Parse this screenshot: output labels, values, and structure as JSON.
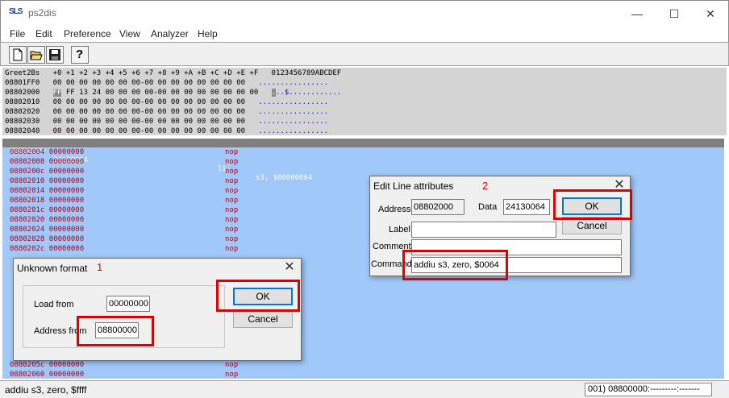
{
  "window": {
    "app_icon_text": "SLS",
    "title": "ps2dis",
    "controls": {
      "minimize": "—",
      "maximize": "☐",
      "close": "✕"
    }
  },
  "menu": [
    "File",
    "Edit",
    "Preference",
    "View",
    "Analyzer",
    "Help"
  ],
  "toolbar": {
    "buttons": [
      {
        "icon": "new-file-icon"
      },
      {
        "icon": "open-folder-icon"
      },
      {
        "icon": "save-disk-icon"
      },
      {
        "icon": "help-icon",
        "glyph": "?"
      }
    ]
  },
  "hex": {
    "header": "Greet2Bs   +0 +1 +2 +3 +4 +5 +6 +7 +8 +9 +A +B +C +D +E +F   0123456789ABCDEF",
    "rows": [
      {
        "addr": "08801FF0",
        "bytes": "00 00 00 00 00 00 00-00 00 00 00 00 00 00 00",
        "ascii": "................"
      },
      {
        "addr": "08802000",
        "sel": "FF",
        "bytes": "FF 13 24 00 00 00 00-00 00 00 00 00 00 00 00",
        "ascii_sel": ".",
        "ascii": "..$............"
      },
      {
        "addr": "08802010",
        "bytes": "00 00 00 00 00 00 00-00 00 00 00 00 00 00 00",
        "ascii": "................"
      },
      {
        "addr": "08802020",
        "bytes": "00 00 00 00 00 00 00-00 00 00 00 00 00 00 00",
        "ascii": "................"
      },
      {
        "addr": "08802030",
        "bytes": "00 00 00 00 00 00 00-00 00 00 00 00 00 00 00",
        "ascii": "................"
      },
      {
        "addr": "08802040",
        "bytes": "00 00 00 00 00 00 00-00 00 00 00 00 00 00 00",
        "ascii": "................"
      }
    ]
  },
  "disasm": {
    "selected": {
      "addr": "08802000",
      "data": "24130064",
      "op": "li",
      "args": "s3, $00000064"
    },
    "rows": [
      {
        "addr": "08802004",
        "data": "00000000",
        "op": "nop"
      },
      {
        "addr": "08802008",
        "data": "00000000",
        "op": "nop"
      },
      {
        "addr": "0880200c",
        "data": "00000000",
        "op": "nop"
      },
      {
        "addr": "08802010",
        "data": "00000000",
        "op": "nop"
      },
      {
        "addr": "08802014",
        "data": "00000000",
        "op": "nop"
      },
      {
        "addr": "08802018",
        "data": "00000000",
        "op": "nop"
      },
      {
        "addr": "0880201c",
        "data": "00000000",
        "op": "nop"
      },
      {
        "addr": "08802020",
        "data": "00000000",
        "op": "nop"
      },
      {
        "addr": "08802024",
        "data": "00000000",
        "op": "nop"
      },
      {
        "addr": "08802028",
        "data": "00000000",
        "op": "nop"
      },
      {
        "addr": "0880202c",
        "data": "00000000",
        "op": "nop"
      }
    ],
    "bottom_rows": [
      {
        "addr": "0880205c",
        "data": "00000000",
        "op": "nop"
      },
      {
        "addr": "08802060",
        "data": "00000000",
        "op": "nop"
      }
    ]
  },
  "dialog_unknown": {
    "title": "Unknown format",
    "annotation": "1",
    "load_from_label": "Load from",
    "load_from_value": "00000000",
    "address_from_label": "Address from",
    "address_from_value": "08800000",
    "ok": "OK",
    "cancel": "Cancel"
  },
  "dialog_edit": {
    "title": "Edit Line attributes",
    "annotation": "2",
    "address_label": "Address",
    "address_value": "08802000",
    "data_label": "Data",
    "data_value": "24130064",
    "label_label": "Label",
    "label_value": "",
    "comment_label": "Comment",
    "comment_value": "",
    "command_label": "Command",
    "command_value": "addiu s3, zero, $0064",
    "ok": "OK",
    "cancel": "Cancel"
  },
  "status": {
    "left": "addiu s3, zero, $ffff",
    "right": "001) 08800000:---------:-------"
  },
  "highlight_color": "#e00000"
}
